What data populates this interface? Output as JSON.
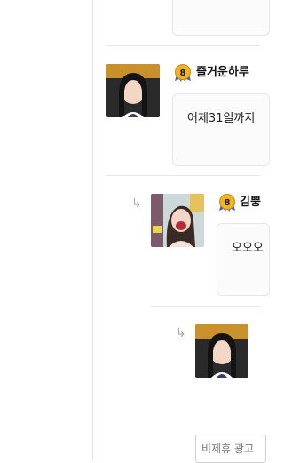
{
  "comments": [
    {
      "nickname": "즐거운하루",
      "level": "8",
      "text": "어제31일까지"
    },
    {
      "nickname": "김뿡",
      "level": "8",
      "text": "오오오"
    }
  ],
  "reply_icon": "reply-arrow-icon",
  "ad_box": {
    "label": "비제휴 광고"
  },
  "colors": {
    "bubble_bg": "#fbfbfb",
    "divider": "#e8e8e8",
    "badge_gold": "#f2b321",
    "badge_blue": "#3e63a8"
  }
}
